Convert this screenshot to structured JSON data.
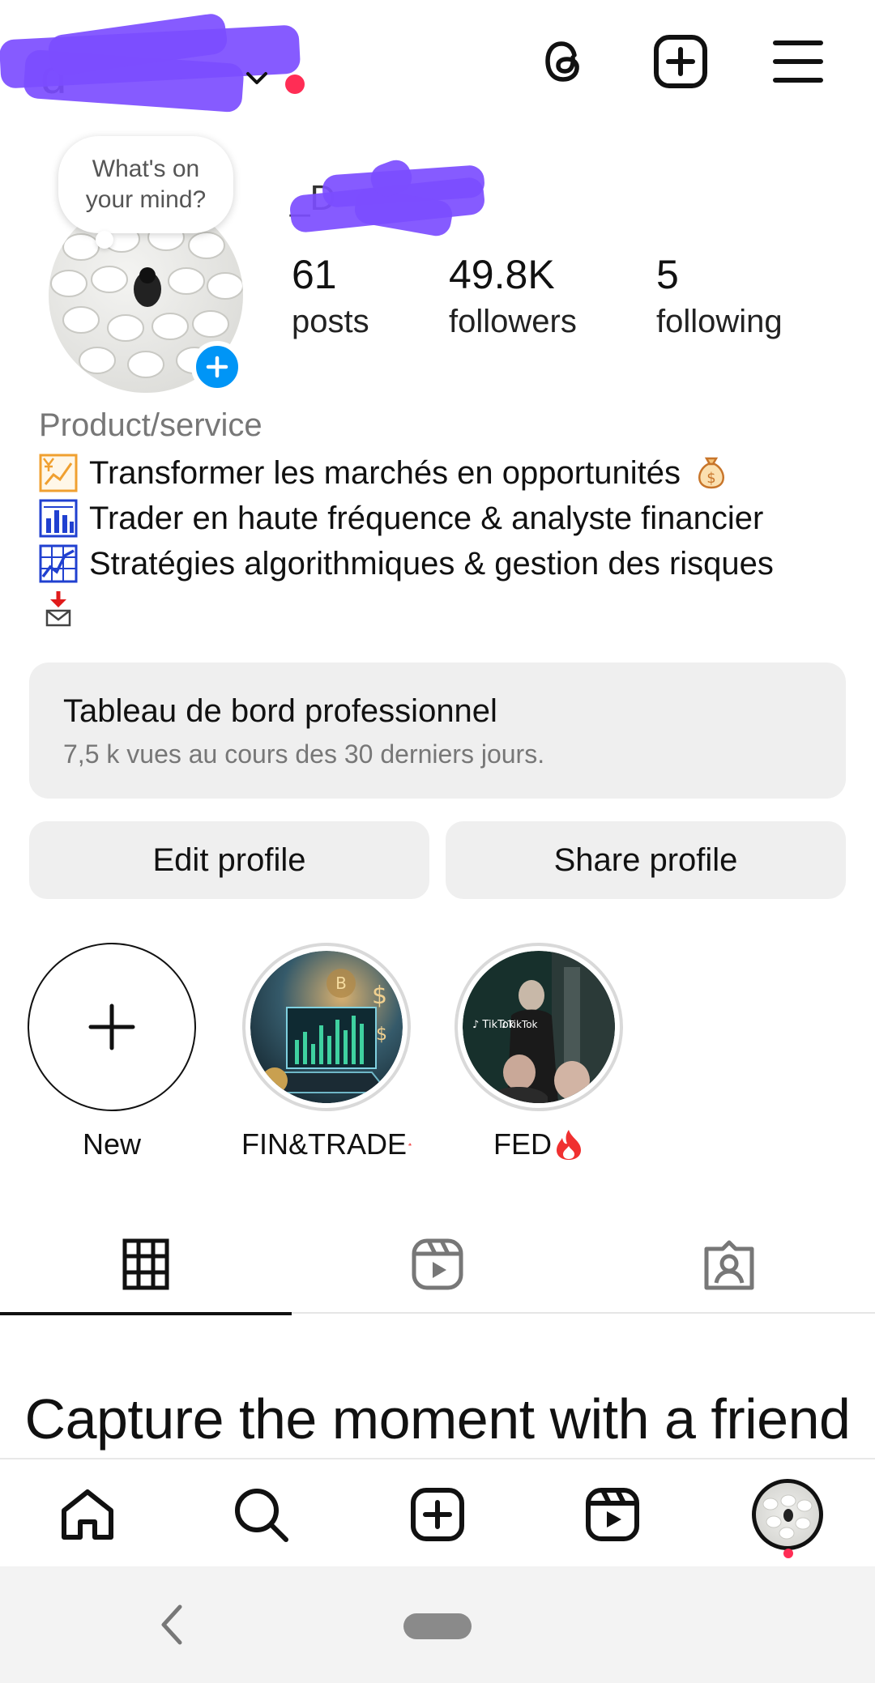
{
  "header": {
    "username": "d",
    "account_switch_icon": "chevron-down-icon",
    "icons": [
      "threads-icon",
      "create-plus-icon",
      "menu-icon"
    ],
    "notification_dot_color": "#ff2d55"
  },
  "profile": {
    "note": "What's on your mind?",
    "display_name": "_D",
    "stats": [
      {
        "value": "61",
        "label": "posts"
      },
      {
        "value": "49.8K",
        "label": "followers"
      },
      {
        "value": "5",
        "label": "following"
      }
    ],
    "category": "Product/service",
    "bio": [
      {
        "icon": "chart-yen-icon",
        "text": "Transformer les marchés en opportunités",
        "trail_icon": "money-bag-icon"
      },
      {
        "icon": "bar-chart-icon",
        "text": "Trader en haute fréquence & analyste financier"
      },
      {
        "icon": "line-chart-icon",
        "text": "Stratégies algorithmiques & gestion des risques"
      }
    ],
    "bio_extra_icon": "inbox-download-icon"
  },
  "dashboard": {
    "title": "Tableau de bord professionnel",
    "subtitle": "7,5 k vues au cours des 30 derniers jours."
  },
  "buttons": {
    "edit": "Edit profile",
    "share": "Share profile"
  },
  "highlights": [
    {
      "label": "New",
      "icon": "plus-icon"
    },
    {
      "label": "FIN&TRADE",
      "trail_icon": "fire-icon"
    },
    {
      "label": "FED",
      "trail_icon": "fire-icon"
    }
  ],
  "tabs": [
    "grid-icon",
    "reels-icon",
    "tagged-icon"
  ],
  "content": {
    "headline": "Capture the moment with a friend"
  },
  "bottom_nav": [
    "home-icon",
    "search-icon",
    "create-icon",
    "reels-icon",
    "profile-avatar"
  ],
  "colors": {
    "accent_blue": "#0095f6",
    "redaction_purple": "#7c4dff",
    "card_bg": "#efefef"
  }
}
